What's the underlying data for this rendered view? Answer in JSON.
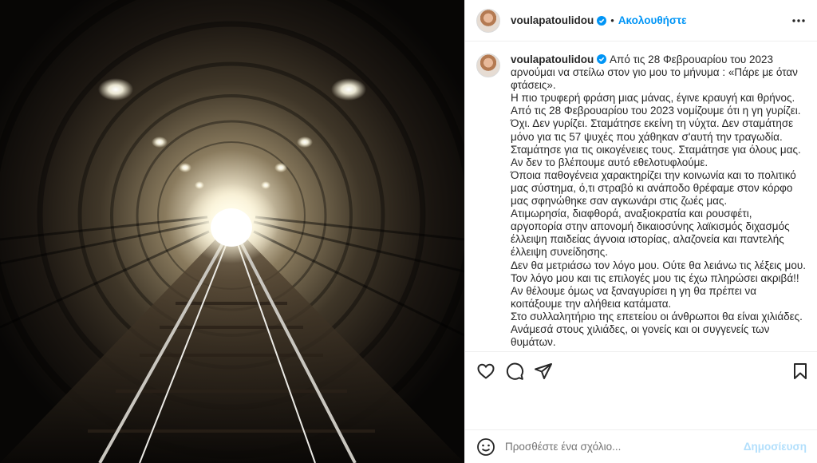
{
  "post": {
    "username": "voulapatoulidou",
    "follow_label": "Ακολουθήστε",
    "separator": "•",
    "caption_first": "Από τις 28 Φεβρουαρίου του 2023 αρνούμαι να στείλω στον γιο μου το μήνυμα : «Πάρε με όταν φτάσεις».",
    "caption_lines": [
      "Η πιο τρυφερή φράση μιας μάνας, έγινε κραυγή και θρήνος.",
      "Από τις 28 Φεβρουαρίου του 2023 νομίζουμε ότι η γη γυρίζει.",
      "Όχι. Δεν γυρίζει. Σταμάτησε εκείνη τη νύχτα. Δεν σταμάτησε μόνο για τις 57 ψυχές που χάθηκαν σ'αυτή την τραγωδία.",
      "Σταμάτησε για τις οικογένειες τους. Σταμάτησε για όλους μας.",
      "Αν δεν το βλέπουμε αυτό εθελοτυφλούμε.",
      "Όποια παθογένεια χαρακτηρίζει την κοινωνία και το πολιτικό μας σύστημα, ό,τι στραβό κι ανάποδο θρέφαμε στον κόρφο μας σφηνώθηκε σαν αγκωνάρι στις ζωές μας.",
      "Ατιμωρησία, διαφθορά, αναξιοκρατία και ρουσφέτι, αργοπορία στην απονομή δικαιοσύνης λαϊκισμός διχασμός έλλειψη παιδείας άγνοια ιστορίας, αλαζονεία και παντελής έλλειψη συνείδησης.",
      "Δεν θα μετριάσω τον λόγο μου. Ούτε θα λειάνω τις λέξεις μου.",
      "Τον λόγο μου και τις επιλογές μου τις έχω πληρώσει ακριβά!!",
      "Αν θέλουμε όμως να ξαναγυρίσει η γη θα πρέπει να κοιτάξουμε την αλήθεια κατάματα.",
      "Στο συλλαλητήριο της επετείου οι άνθρωποι θα είναι χιλιάδες. Ανάμεσά στους χιλιάδες, οι γονείς και οι συγγενείς των θυμάτων."
    ]
  },
  "comment": {
    "placeholder": "Προσθέστε ένα σχόλιο...",
    "post_label": "Δημοσίευση"
  },
  "icons": {
    "more": "more-options-icon",
    "verified": "verified-badge-icon",
    "like": "heart-icon",
    "comment": "comment-icon",
    "share": "share-icon",
    "save": "bookmark-icon",
    "emoji": "emoji-icon"
  },
  "colors": {
    "accent": "#0095f6",
    "text": "#262626",
    "muted": "#737373"
  }
}
